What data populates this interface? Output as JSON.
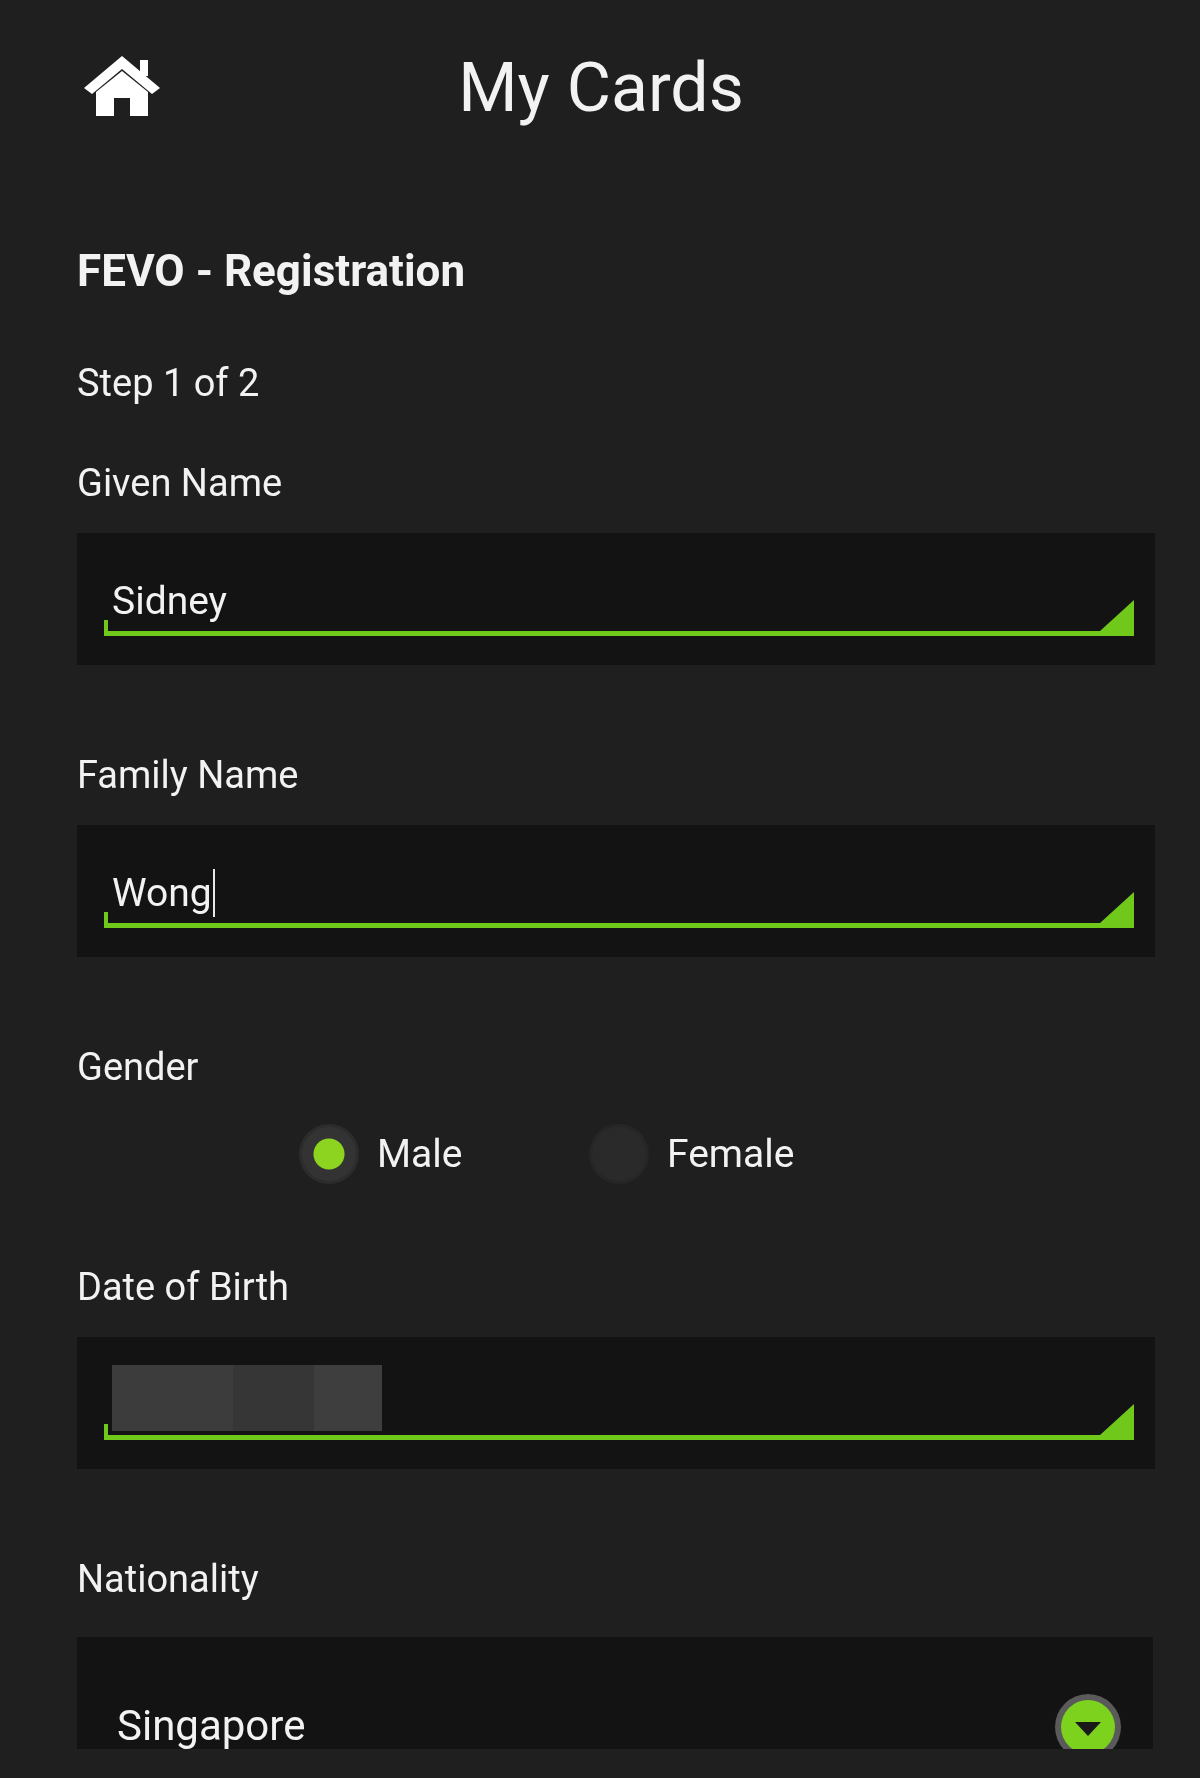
{
  "header": {
    "title": "My Cards"
  },
  "form_title": "FEVO - Registration",
  "step": "Step 1 of 2",
  "fields": [
    {
      "kind": "text",
      "label": "Given Name",
      "value": "Sidney",
      "focused": false
    },
    {
      "kind": "text",
      "label": "Family Name",
      "value": "Wong",
      "focused": true
    },
    {
      "kind": "radio",
      "label": "Gender",
      "options": [
        {
          "label": "Male",
          "selected": true
        },
        {
          "label": "Female",
          "selected": false
        }
      ]
    },
    {
      "kind": "text",
      "label": "Date of Birth",
      "redacted": true
    },
    {
      "kind": "select",
      "label": "Nationality",
      "value": "Singapore"
    }
  ]
}
